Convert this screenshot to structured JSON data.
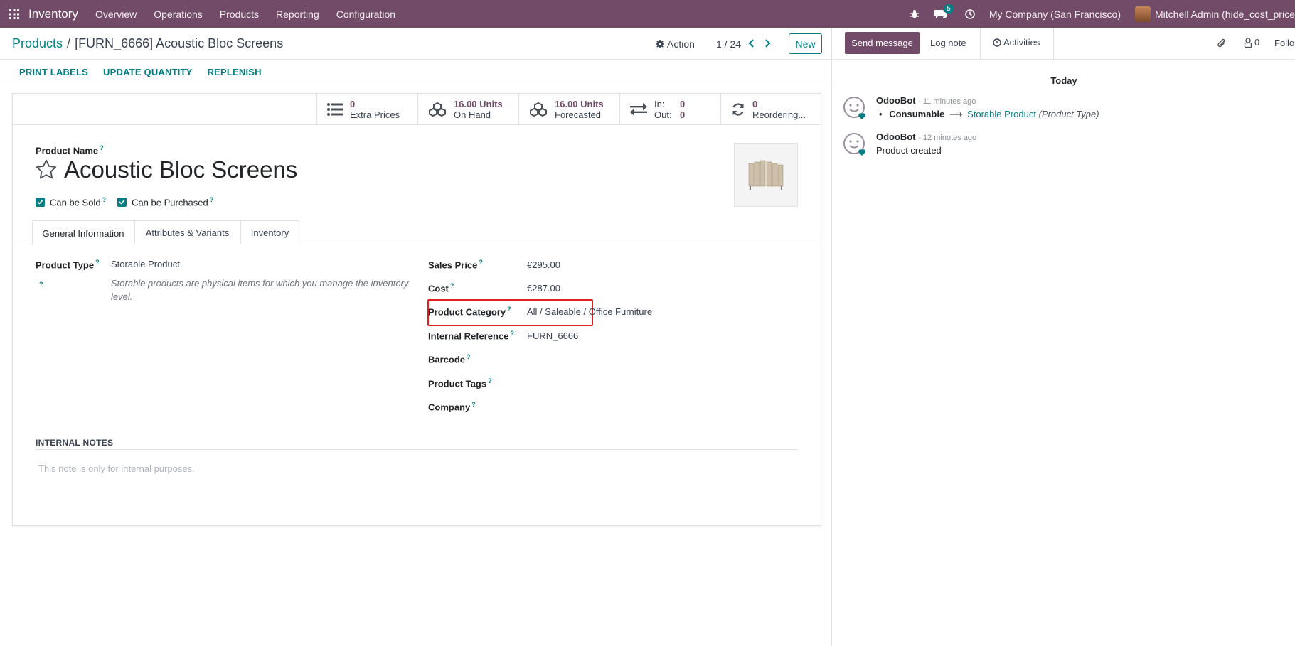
{
  "navbar": {
    "app_name": "Inventory",
    "menu": [
      "Overview",
      "Operations",
      "Products",
      "Reporting",
      "Configuration"
    ],
    "messages_badge": "5",
    "company": "My Company (San Francisco)",
    "user": "Mitchell Admin (hide_cost_price_",
    "color": "#714B67"
  },
  "control_panel": {
    "breadcrumb_parent": "Products",
    "breadcrumb_sep": "/",
    "breadcrumb_current": "[FURN_6666] Acoustic Bloc Screens",
    "action_label": "Action",
    "pager": "1 / 24",
    "new_label": "New"
  },
  "statusbar": {
    "buttons": [
      "PRINT LABELS",
      "UPDATE QUANTITY",
      "REPLENISH"
    ]
  },
  "smart_buttons": {
    "extra_prices": {
      "value": "0",
      "label": "Extra Prices"
    },
    "on_hand": {
      "value": "16.00 Units",
      "label": "On Hand"
    },
    "forecasted": {
      "value": "16.00 Units",
      "label": "Forecasted"
    },
    "in_out": {
      "in_label": "In:",
      "in_value": "0",
      "out_label": "Out:",
      "out_value": "0"
    },
    "reordering": {
      "value": "0",
      "label": "Reordering..."
    }
  },
  "product": {
    "name_label": "Product Name",
    "name": "Acoustic Bloc Screens",
    "can_be_sold": "Can be Sold",
    "can_be_purchased": "Can be Purchased",
    "help_mark": "?"
  },
  "tabs": [
    "General Information",
    "Attributes & Variants",
    "Inventory"
  ],
  "general": {
    "product_type_label": "Product Type",
    "product_type": "Storable Product",
    "product_type_help": "Storable products are physical items for which you manage the inventory level.",
    "sales_price_label": "Sales Price",
    "sales_price": "€295.00",
    "cost_label": "Cost",
    "cost": "€287.00",
    "category_label": "Product Category",
    "category": "All / Saleable / Office Furniture",
    "internal_ref_label": "Internal Reference",
    "internal_ref": "FURN_6666",
    "barcode_label": "Barcode",
    "tags_label": "Product Tags",
    "company_label": "Company"
  },
  "notes": {
    "title": "INTERNAL NOTES",
    "placeholder": "This note is only for internal purposes."
  },
  "chatter": {
    "send_message": "Send message",
    "log_note": "Log note",
    "activities": "Activities",
    "followers_count": "0",
    "follow": "Follo",
    "date_separator": "Today",
    "messages": [
      {
        "author": "OdooBot",
        "time": "- 11 minutes ago",
        "old": "Consumable",
        "arrow": "⟶",
        "new": "Storable Product",
        "field": "(Product Type)"
      },
      {
        "author": "OdooBot",
        "time": "- 12 minutes ago",
        "body": "Product created"
      }
    ]
  }
}
